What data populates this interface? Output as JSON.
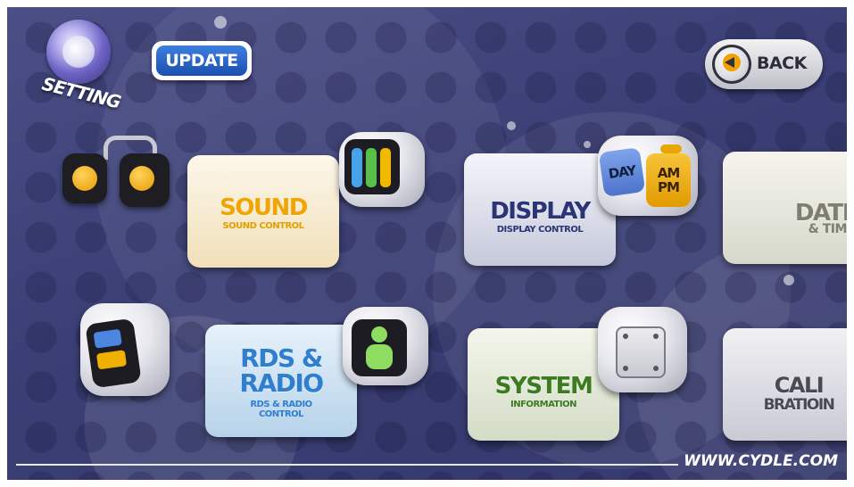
{
  "header": {
    "setting_label": "SETTING",
    "update_label": "UPDATE",
    "back_label": "BACK"
  },
  "tiles": {
    "sound": {
      "title": "SOUND",
      "subtitle": "SOUND CONTROL"
    },
    "display": {
      "title": "DISPLAY",
      "subtitle": "DISPLAY CONTROL"
    },
    "date": {
      "title": "DATE",
      "subtitle": "& TIME",
      "icon_day": "DAY",
      "icon_am": "AM",
      "icon_pm": "PM"
    },
    "rds": {
      "title_line1": "RDS &",
      "title_line2": "RADIO",
      "subtitle_line1": "RDS & RADIO",
      "subtitle_line2": "CONTROL"
    },
    "system": {
      "title": "SYSTEM",
      "subtitle": "INFORMATION"
    },
    "calibration": {
      "title_line1": "CALI",
      "title_line2": "BRATIOIN"
    }
  },
  "footer": {
    "website": "WWW.CYDLE.COM"
  },
  "colors": {
    "background": "#3b3f75",
    "sound_accent": "#f0a500",
    "display_accent": "#2b3475",
    "date_accent": "#7e7e72",
    "rds_accent": "#2e7fd0",
    "system_accent": "#3d7b20",
    "calibration_accent": "#4a4a55",
    "update_button": "#1b4fb1"
  },
  "icons": {
    "setting": "setting-gear-icon",
    "back": "back-arrow-icon",
    "sound": "speaker-icon",
    "display": "display-monitor-icon",
    "date": "calendar-clock-icon",
    "rds": "radio-icon",
    "system": "person-info-icon",
    "calibration": "touch-calibration-icon"
  }
}
